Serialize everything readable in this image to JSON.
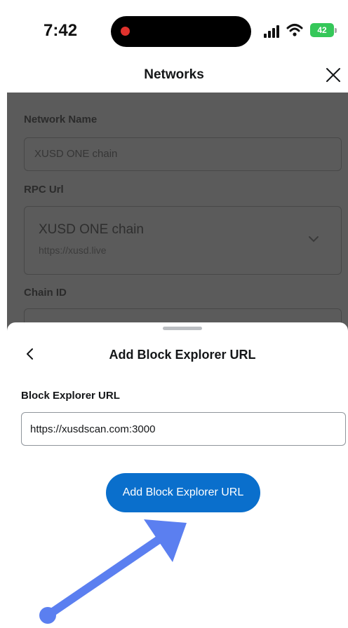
{
  "status_bar": {
    "time": "7:42",
    "battery": "42"
  },
  "header": {
    "title": "Networks"
  },
  "background_form": {
    "network_name_label": "Network Name",
    "network_name_value": "XUSD ONE chain",
    "rpc_url_label": "RPC Url",
    "rpc_name": "XUSD ONE chain",
    "rpc_url": "https://xusd.live",
    "chain_id_label": "Chain ID"
  },
  "sheet": {
    "title": "Add Block Explorer URL",
    "input_label": "Block Explorer URL",
    "input_value": "https://xusdscan.com:3000",
    "button_label": "Add Block Explorer URL"
  },
  "colors": {
    "accent": "#0a6fcc",
    "annotation_arrow": "#5b7ff0",
    "overlay": "#5b5b5b",
    "recording_dot": "#e0322d",
    "battery": "#35c759"
  },
  "icons": [
    "signal-icon",
    "wifi-icon",
    "close-icon",
    "chevron-down-icon",
    "back-chevron-icon",
    "annotation-arrow-icon"
  ]
}
